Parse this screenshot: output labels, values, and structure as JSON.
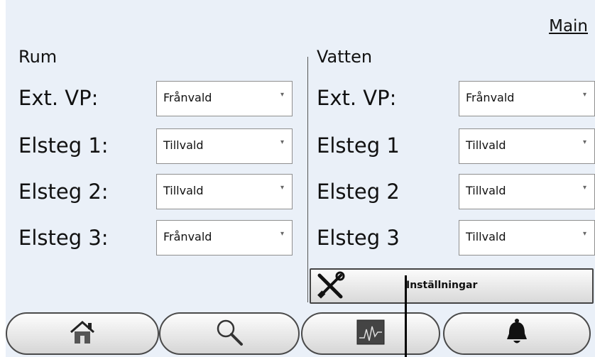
{
  "header": {
    "main_link": "Main"
  },
  "rum": {
    "title": "Rum",
    "rows": [
      {
        "label": "Ext. VP:",
        "value": "Frånvald"
      },
      {
        "label": "Elsteg 1:",
        "value": "Tillvald"
      },
      {
        "label": "Elsteg 2:",
        "value": "Tillvald"
      },
      {
        "label": "Elsteg 3:",
        "value": "Frånvald"
      }
    ]
  },
  "vatten": {
    "title": "Vatten",
    "rows": [
      {
        "label": "Ext. VP:",
        "value": "Frånvald"
      },
      {
        "label": "Elsteg 1",
        "value": "Tillvald"
      },
      {
        "label": "Elsteg 2",
        "value": "Tillvald"
      },
      {
        "label": "Elsteg 3",
        "value": "Tillvald"
      }
    ]
  },
  "settings_button": {
    "label": "Inställningar",
    "icon": "tools-icon"
  },
  "bottom_nav": [
    {
      "icon": "home-icon"
    },
    {
      "icon": "search-icon"
    },
    {
      "icon": "chart-icon"
    },
    {
      "icon": "bell-icon"
    }
  ],
  "colors": {
    "background": "#eaf0f8",
    "button_border": "#4a4a4a"
  }
}
